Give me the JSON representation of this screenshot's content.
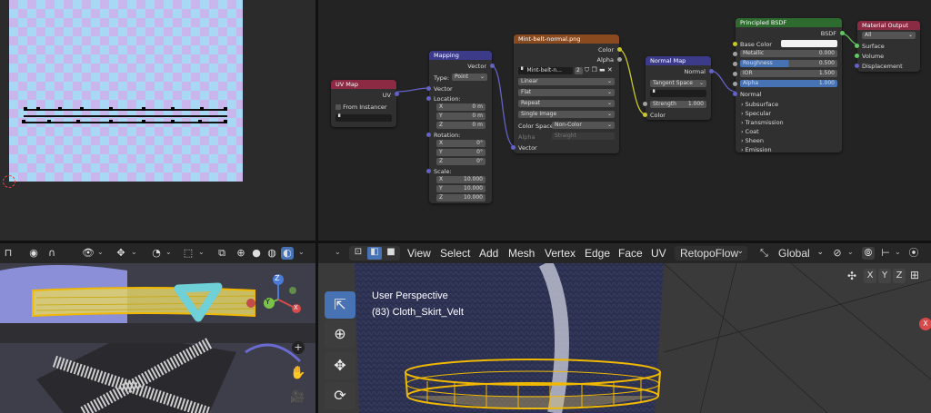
{
  "node_editor": {
    "uv_map": {
      "title": "UV Map",
      "out_uv": "UV",
      "from_instancer": "From Instancer"
    },
    "mapping": {
      "title": "Mapping",
      "out_vector": "Vector",
      "type_label": "Type:",
      "type_value": "Point",
      "in_vector": "Vector",
      "location_label": "Location:",
      "location": [
        {
          "axis": "X",
          "value": "0 m"
        },
        {
          "axis": "Y",
          "value": "0 m"
        },
        {
          "axis": "Z",
          "value": "0 m"
        }
      ],
      "rotation_label": "Rotation:",
      "rotation": [
        {
          "axis": "X",
          "value": "0°"
        },
        {
          "axis": "Y",
          "value": "0°"
        },
        {
          "axis": "Z",
          "value": "0°"
        }
      ],
      "scale_label": "Scale:",
      "scale": [
        {
          "axis": "X",
          "value": "10.000"
        },
        {
          "axis": "Y",
          "value": "10.000"
        },
        {
          "axis": "Z",
          "value": "10.000"
        }
      ]
    },
    "image_texture": {
      "title": "Mint-belt-normal.png",
      "out_color": "Color",
      "out_alpha": "Alpha",
      "image_name": "Mint-belt-n...",
      "users": "2",
      "interpolation": "Linear",
      "projection": "Flat",
      "extension": "Repeat",
      "source": "Single Image",
      "color_space_label": "Color Space",
      "color_space": "Non-Color",
      "alpha_label": "Alpha",
      "alpha_value": "Straight",
      "in_vector": "Vector"
    },
    "normal_map": {
      "title": "Normal Map",
      "out_normal": "Normal",
      "space": "Tangent Space",
      "strength_label": "Strength",
      "strength_value": "1.000",
      "in_color": "Color"
    },
    "principled": {
      "title": "Principled BSDF",
      "out_bsdf": "BSDF",
      "base_color": "Base Color",
      "metallic_label": "Metallic",
      "metallic_value": "0.000",
      "roughness_label": "Roughness",
      "roughness_value": "0.500",
      "ior_label": "IOR",
      "ior_value": "1.500",
      "alpha_label": "Alpha",
      "alpha_value": "1.000",
      "normal": "Normal",
      "panels": [
        "Subsurface",
        "Specular",
        "Transmission",
        "Coat",
        "Sheen",
        "Emission"
      ]
    },
    "material_output": {
      "title": "Material Output",
      "target": "All",
      "surface": "Surface",
      "volume": "Volume",
      "displacement": "Displacement"
    }
  },
  "viewport_right": {
    "menu": [
      "View",
      "Select",
      "Add",
      "Mesh",
      "Vertex",
      "Edge",
      "Face",
      "UV"
    ],
    "addon_menu": "RetopoFlow",
    "orientation": "Global",
    "info_line1": "User Perspective",
    "info_line2": "(83) Cloth_Skirt_Velt",
    "axis_x": "X",
    "axis_y": "Y",
    "axis_z": "Z"
  },
  "viewport_left": {
    "gizmo_z": "Z",
    "gizmo_y": "Y",
    "gizmo_x": "X"
  },
  "colors": {
    "uv_map_header": "#8c2a44",
    "mapping_header": "#3b3b8a",
    "image_header": "#8a4a1f",
    "normal_map_header": "#3b3b8a",
    "principled_header": "#2e6b2e",
    "output_header": "#8c2a44",
    "selection": "#f0b800"
  }
}
